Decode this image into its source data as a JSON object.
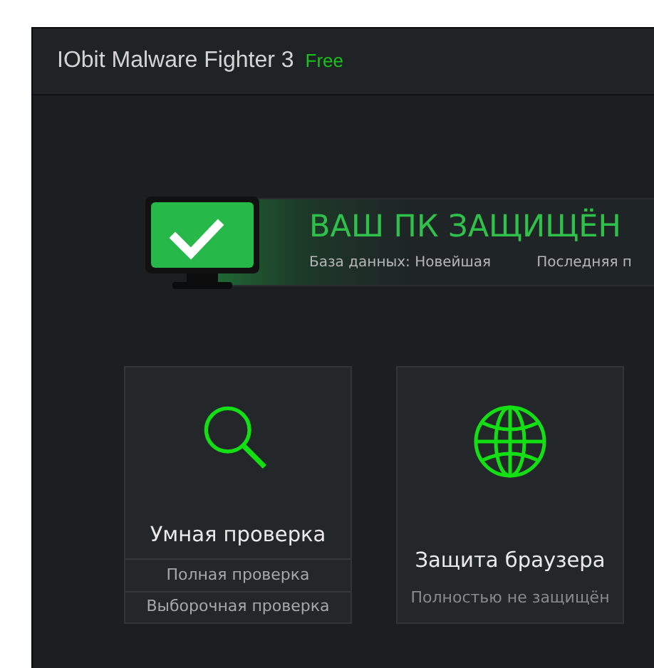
{
  "window": {
    "title": "IObit Malware Fighter 3",
    "edition": "Free"
  },
  "status": {
    "headline": "ВАШ ПК ЗАЩИЩЁН",
    "protected": true,
    "details": [
      "База данных: Новейшая",
      "Последняя п"
    ]
  },
  "tiles": [
    {
      "kind": "scan",
      "title": "Умная проверка",
      "options": [
        "Полная проверка",
        "Выборочная проверка"
      ]
    },
    {
      "kind": "browser",
      "title": "Защита браузера",
      "subtitle": "Полностью не защищён"
    }
  ]
}
